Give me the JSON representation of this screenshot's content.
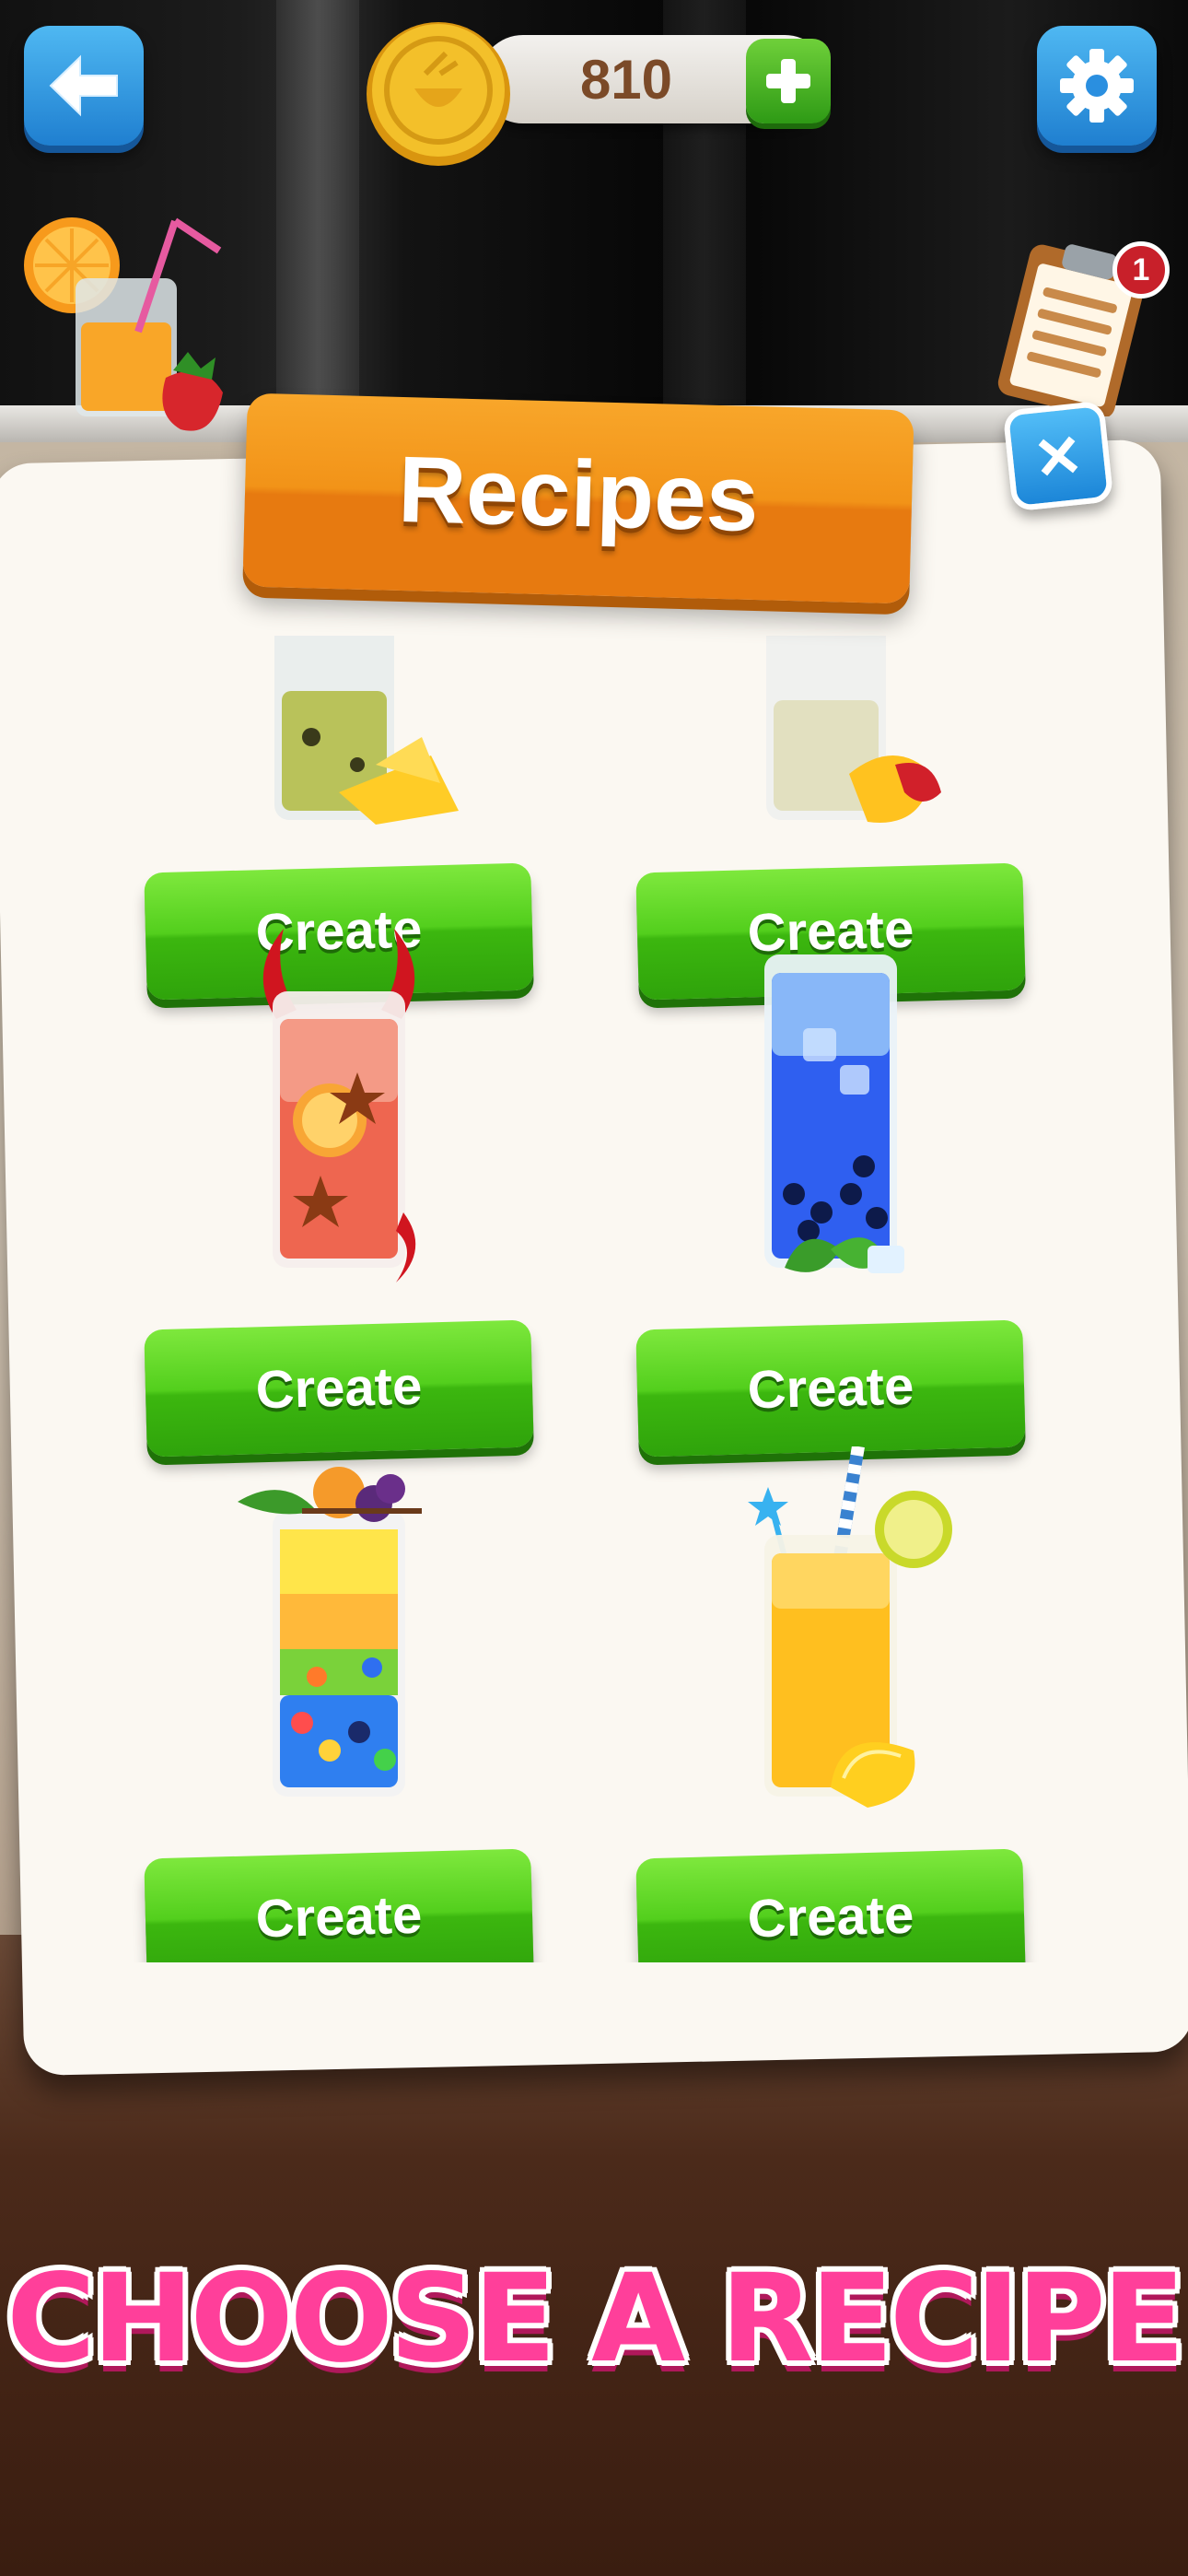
{
  "hud": {
    "coins": "810",
    "notification_count": "1"
  },
  "panel": {
    "title": "Recipes"
  },
  "recipes": [
    {
      "drink": "kiwi-pineapple",
      "button": "Create"
    },
    {
      "drink": "peach-apple",
      "button": "Create"
    },
    {
      "drink": "devil-spiced-orange",
      "button": "Create"
    },
    {
      "drink": "blue-bubble-tea",
      "button": "Create"
    },
    {
      "drink": "rainbow-bubble-tea",
      "button": "Create"
    },
    {
      "drink": "lemonade",
      "button": "Create"
    }
  ],
  "caption": "CHOOSE A RECIPE",
  "colors": {
    "accent_blue": "#2a93e0",
    "create_green": "#48c319",
    "banner_orange": "#f29318",
    "caption_pink": "#ff3f9a"
  }
}
